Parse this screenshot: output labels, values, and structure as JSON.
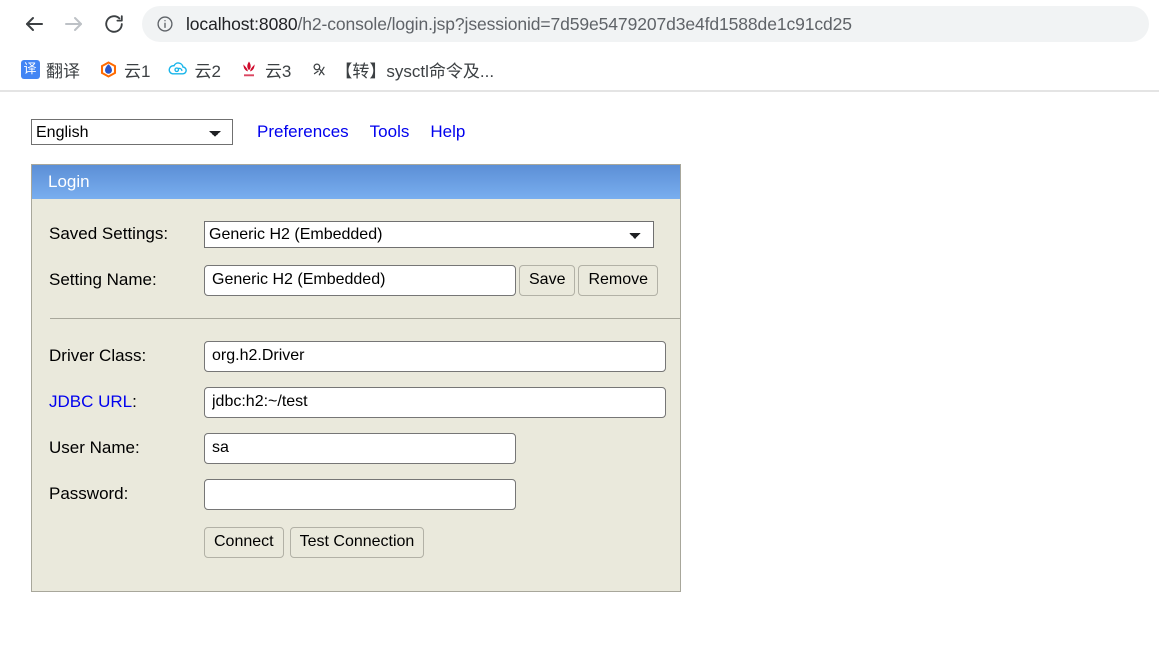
{
  "browser": {
    "nav": {
      "back_icon": "arrow-left-icon",
      "forward_icon": "arrow-right-icon",
      "reload_icon": "reload-icon"
    },
    "omnibox": {
      "site_info_icon": "info-circle-icon",
      "url_host": "localhost:8080",
      "url_path": "/h2-console/login.jsp?jsessionid=7d59e5479207d3e4fd1588de1c91cd25",
      "url_full": "localhost:8080/h2-console/login.jsp?jsessionid=7d59e5479207d3e4fd1588de1c91cd25"
    },
    "bookmarks": [
      {
        "label": "翻译",
        "icon": "translate-icon"
      },
      {
        "label": "云1",
        "icon": "shield-hex-icon"
      },
      {
        "label": "云2",
        "icon": "cloud-icon"
      },
      {
        "label": "云3",
        "icon": "huawei-flower-icon"
      },
      {
        "label": "【转】sysctl命令及...",
        "icon": "generic-page-icon"
      }
    ]
  },
  "toolbar": {
    "language_selected": "English",
    "language_options": [
      "English"
    ],
    "links": [
      {
        "label": "Preferences"
      },
      {
        "label": "Tools"
      },
      {
        "label": "Help"
      }
    ]
  },
  "login_panel": {
    "header_title": "Login",
    "saved_settings": {
      "label": "Saved Settings:",
      "selected": "Generic H2 (Embedded)",
      "options": [
        "Generic H2 (Embedded)"
      ]
    },
    "setting_name": {
      "label": "Setting Name:",
      "value": "Generic H2 (Embedded)",
      "placeholder": "",
      "save_button": "Save",
      "remove_button": "Remove"
    },
    "driver_class": {
      "label": "Driver Class:",
      "value": "org.h2.Driver",
      "placeholder": ""
    },
    "jdbc_url": {
      "label_link": "JDBC URL",
      "label_colon": ":",
      "value": "jdbc:h2:~/test",
      "placeholder": ""
    },
    "user_name": {
      "label": "User Name:",
      "value": "sa",
      "placeholder": ""
    },
    "password": {
      "label": "Password:",
      "value": "",
      "placeholder": ""
    },
    "actions": {
      "connect_button": "Connect",
      "test_connection_button": "Test Connection"
    }
  },
  "colors": {
    "header_gradient_top": "#5c8fd6",
    "header_gradient_bottom": "#79aeef",
    "panel_bg": "#eae9dc",
    "panel_border": "#a8a79b",
    "link_blue": "#0000ee",
    "omnibox_bg": "#f1f3f4",
    "url_text": "#5f6368"
  }
}
